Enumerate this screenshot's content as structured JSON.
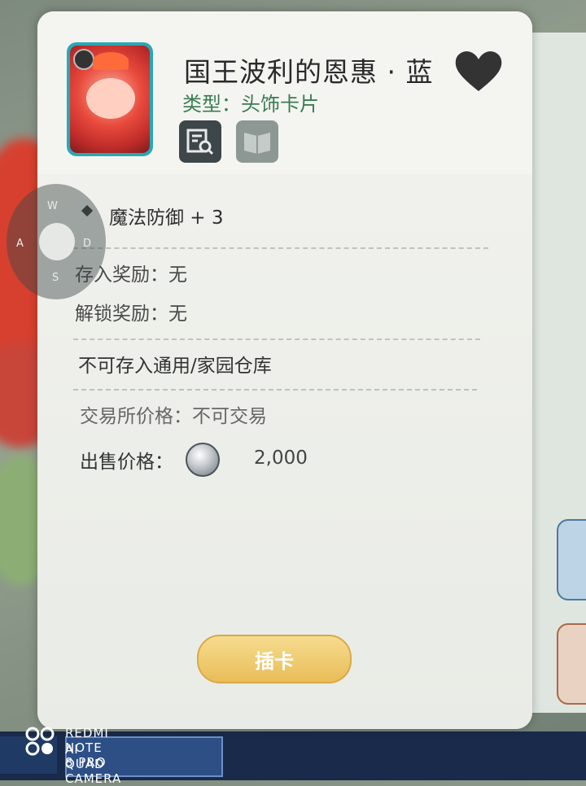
{
  "card": {
    "title": "国王波利的恩惠 · 蓝",
    "type_label": "类型：头饰卡片",
    "attributes": [
      {
        "label": "魔法防御 + 3"
      }
    ],
    "deposit_reward": "存入奖励：无",
    "unlock_reward": "解锁奖励：无",
    "warehouse_note": "不可存入通用/家园仓库",
    "exchange_price": "交易所价格：不可交易",
    "sell_price_label": "出售价格：",
    "sell_price_value": "2,000",
    "insert_button": "插卡",
    "accent_color": "#2aa7b5",
    "type_color": "#3a7c54"
  },
  "joystick": {
    "labels": {
      "w": "W",
      "a": "A",
      "s": "S",
      "d": "D"
    }
  },
  "watermark": {
    "line1": "REDMI NOTE 8 PRO",
    "line2": "AI QUAD CAMERA"
  },
  "icons": {
    "inspect": "inspect-icon",
    "book": "book-icon",
    "favorite": "heart-icon",
    "coin": "coin-icon"
  }
}
